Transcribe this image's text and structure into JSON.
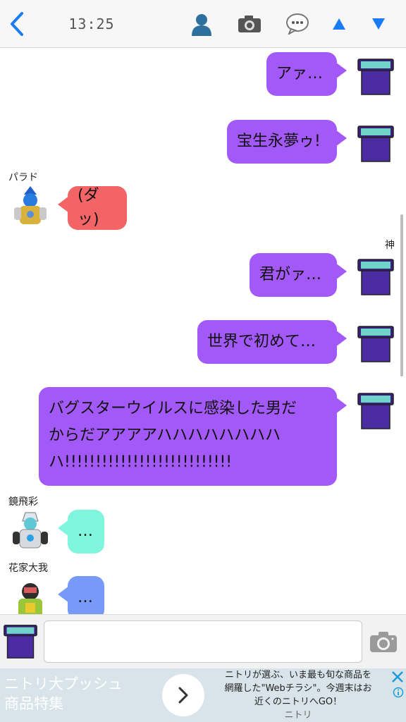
{
  "header": {
    "time": "13:25",
    "colors": {
      "icon": "#1a7cf5",
      "profile": "#2e6f9e",
      "chat": "#777777"
    }
  },
  "messages": [
    {
      "side": "out",
      "text": "アァ…"
    },
    {
      "side": "out",
      "text": "宝生永夢ゥ!"
    },
    {
      "side": "in",
      "sender": "パラド",
      "text": "(ダッ)",
      "color": "#f26466"
    },
    {
      "side": "out",
      "sender": "神",
      "text": "君がァ…"
    },
    {
      "side": "out",
      "text": "世界で初めて…"
    },
    {
      "side": "out",
      "lines": [
        "バグスターウイルスに感染した男だ",
        "からだアアアアハハハハハハハハ",
        "ハ!!!!!!!!!!!!!!!!!!!!!!!!!!!"
      ]
    },
    {
      "side": "in",
      "sender": "鏡飛彩",
      "text": "…",
      "color": "#80f5de"
    },
    {
      "side": "in",
      "sender": "花家大我",
      "text": "…",
      "color": "#7799f7"
    }
  ],
  "colors": {
    "outgoing": "#a259f7"
  },
  "input": {
    "placeholder": ""
  },
  "ad": {
    "title_lines": [
      "ニトリ大プッシュ",
      "商品特集"
    ],
    "desc_lines": [
      "ニトリが選ぶ、いま最も旬な商品を",
      "網羅した\"Webチラシ\"。今週末はお",
      "近くのニトリへGO！"
    ],
    "brand": "ニトリ"
  }
}
